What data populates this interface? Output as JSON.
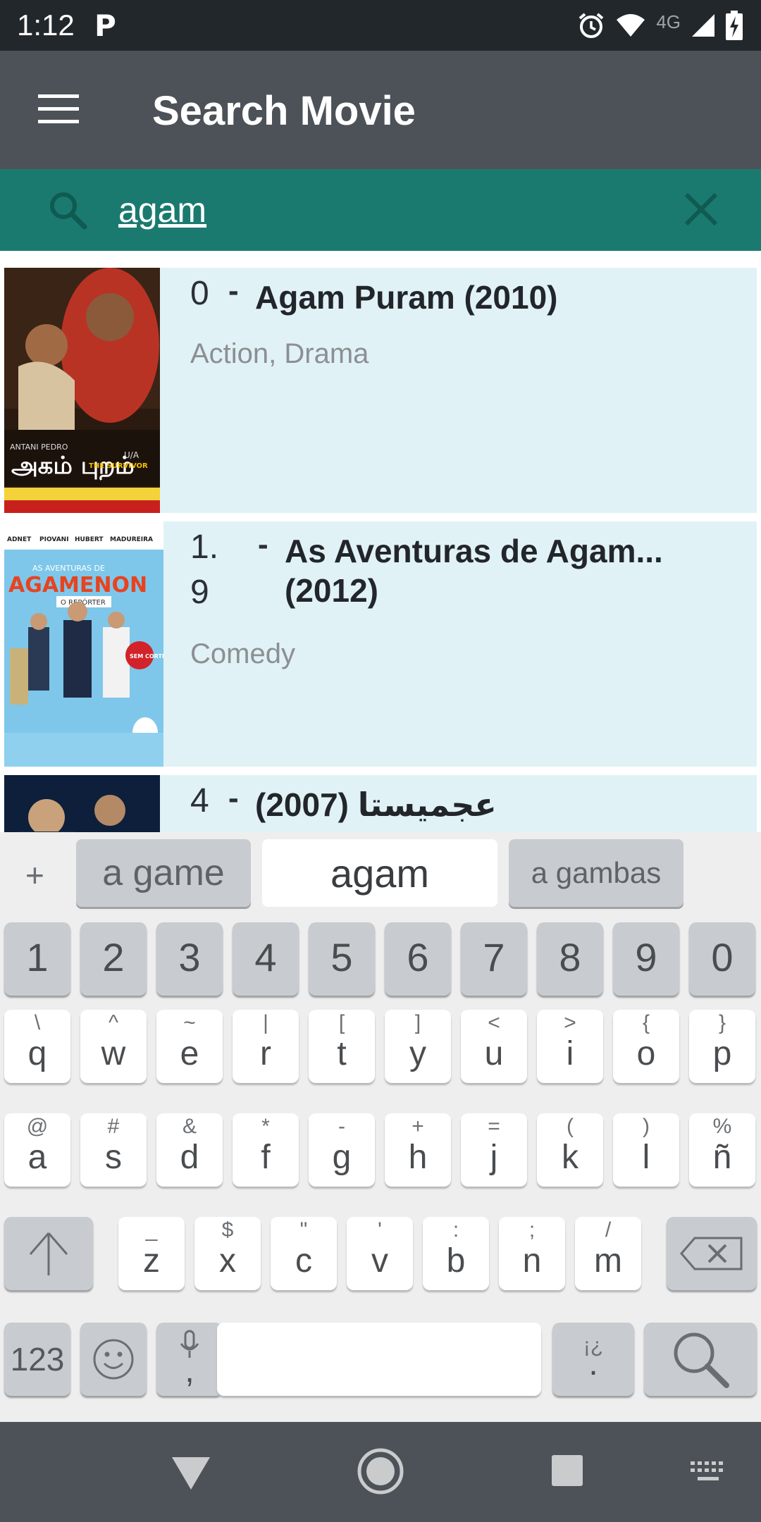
{
  "status_bar": {
    "time": "1:12",
    "app_icon_letter": "P",
    "network_label": "4G",
    "icons": [
      "alarm-icon",
      "wifi-icon",
      "signal-icon",
      "battery-charging-icon"
    ]
  },
  "app_bar": {
    "title": "Search Movie",
    "menu_icon": "hamburger-menu-icon"
  },
  "search": {
    "value": "agam",
    "search_icon": "search-icon",
    "clear_icon": "close-icon"
  },
  "results": [
    {
      "index": "0",
      "index_lines": [
        "0"
      ],
      "title": "Agam Puram (2010)",
      "genres": "Action, Drama"
    },
    {
      "index": "1.9",
      "index_lines": [
        "1.",
        "9"
      ],
      "title_line1": "As Aventuras de Agam...",
      "title_line2": "(2012)",
      "genres": "Comedy"
    },
    {
      "index": "4",
      "index_lines": [
        "4"
      ],
      "title": "عجميستا (2007)",
      "genres": ""
    }
  ],
  "poster_text": {
    "p1": {
      "names": "ANTANI  PEDRO",
      "logo": "அகம் புறம்",
      "sub": "U/A",
      "tag": "THE SURVIVOR"
    },
    "p2": {
      "cast": [
        "ADNET",
        "PIOVANI",
        "HUBERT",
        "MADUREIRA"
      ],
      "pre": "AS AVENTURAS DE",
      "logo": "AGAMENON",
      "sub": "O REPÓRTER",
      "badge": "SEM CORTES!"
    }
  },
  "keyboard": {
    "suggestions_plus": "+",
    "suggestions": [
      "a game",
      "agam",
      "a gambas"
    ],
    "number_row": [
      "1",
      "2",
      "3",
      "4",
      "5",
      "6",
      "7",
      "8",
      "9",
      "0"
    ],
    "row1": [
      {
        "k": "q",
        "h": "\\"
      },
      {
        "k": "w",
        "h": "^"
      },
      {
        "k": "e",
        "h": "~"
      },
      {
        "k": "r",
        "h": "|"
      },
      {
        "k": "t",
        "h": "["
      },
      {
        "k": "y",
        "h": "]"
      },
      {
        "k": "u",
        "h": "<"
      },
      {
        "k": "i",
        "h": ">"
      },
      {
        "k": "o",
        "h": "{"
      },
      {
        "k": "p",
        "h": "}"
      }
    ],
    "row2": [
      {
        "k": "a",
        "h": "@"
      },
      {
        "k": "s",
        "h": "#"
      },
      {
        "k": "d",
        "h": "&"
      },
      {
        "k": "f",
        "h": "*"
      },
      {
        "k": "g",
        "h": "-"
      },
      {
        "k": "h",
        "h": "+"
      },
      {
        "k": "j",
        "h": "="
      },
      {
        "k": "k",
        "h": "("
      },
      {
        "k": "l",
        "h": ")"
      },
      {
        "k": "ñ",
        "h": "%"
      }
    ],
    "row3": [
      {
        "k": "z",
        "h": "_"
      },
      {
        "k": "x",
        "h": "$"
      },
      {
        "k": "c",
        "h": "\""
      },
      {
        "k": "v",
        "h": "'"
      },
      {
        "k": "b",
        "h": ":"
      },
      {
        "k": "n",
        "h": ";"
      },
      {
        "k": "m",
        "h": "/"
      }
    ],
    "bottom": {
      "symbols": "123",
      "comma": ",",
      "period": ".",
      "period_hint": "¡¿"
    }
  },
  "nav_bar": {
    "icons": [
      "back-triangle-icon",
      "home-circle-icon",
      "recents-square-icon",
      "keyboard-switch-icon"
    ]
  },
  "colors": {
    "status_bar": "#22272b",
    "app_bar": "#4c5257",
    "search_bar": "#1b7a6f",
    "list_item_bg": "#e0f2f6",
    "keyboard_bg": "#eeeeee"
  }
}
